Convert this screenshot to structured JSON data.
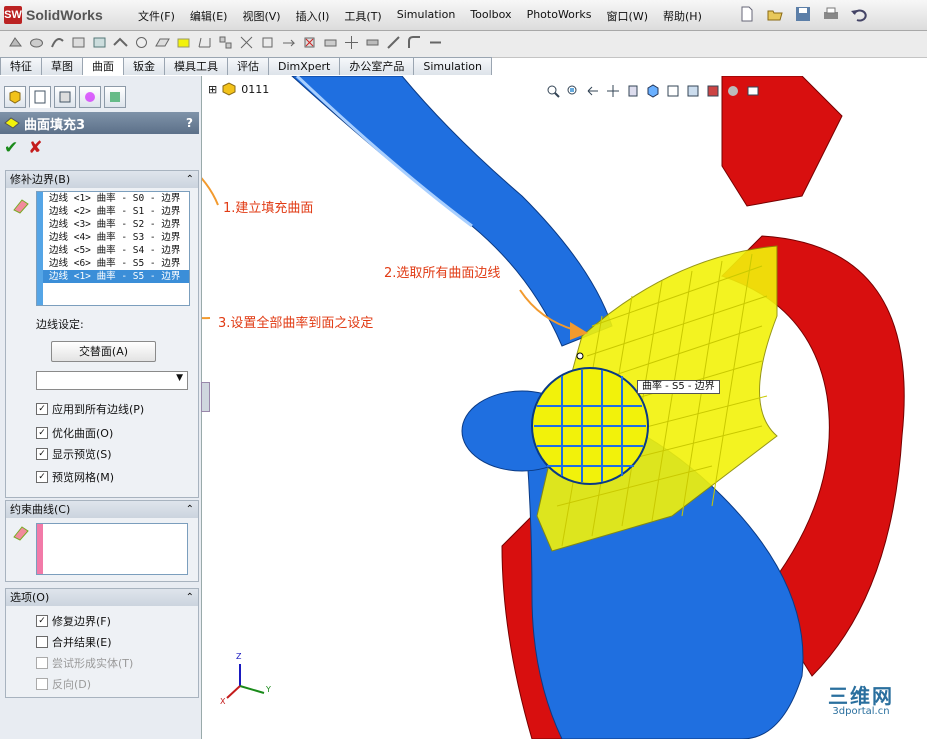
{
  "app": {
    "logo": "SolidWorks"
  },
  "menu": [
    "文件(F)",
    "编辑(E)",
    "视图(V)",
    "插入(I)",
    "工具(T)",
    "Simulation",
    "Toolbox",
    "PhotoWorks",
    "窗口(W)",
    "帮助(H)"
  ],
  "tabs": [
    {
      "label": "特征",
      "active": false
    },
    {
      "label": "草图",
      "active": false
    },
    {
      "label": "曲面",
      "active": true
    },
    {
      "label": "钣金",
      "active": false
    },
    {
      "label": "模具工具",
      "active": false
    },
    {
      "label": "评估",
      "active": false
    },
    {
      "label": "DimXpert",
      "active": false
    },
    {
      "label": "办公室产品",
      "active": false
    },
    {
      "label": "Simulation",
      "active": false
    }
  ],
  "tree": {
    "part_name": "0111"
  },
  "panel": {
    "title": "曲面填充3",
    "help": "?",
    "ok_glyph": "✔",
    "cancel_glyph": "✘",
    "patch_boundary": {
      "header": "修补边界(B)",
      "items": [
        "边线 <1> 曲率 - S0 - 边界",
        "边线 <2> 曲率 - S1 - 边界",
        "边线 <3> 曲率 - S2 - 边界",
        "边线 <4> 曲率 - S3 - 边界",
        "边线 <5> 曲率 - S4 - 边界",
        "边线 <6> 曲率 - S5 - 边界",
        "边线 <1> 曲率 - S5 - 边界"
      ],
      "selected_index": 6,
      "edge_settings_label": "边线设定:",
      "alternate_face_button": "交替面(A)",
      "combo_value": "",
      "options": [
        {
          "label": "应用到所有边线(P)",
          "checked": true
        },
        {
          "label": "优化曲面(O)",
          "checked": true
        },
        {
          "label": "显示预览(S)",
          "checked": true
        },
        {
          "label": "预览网格(M)",
          "checked": true
        }
      ]
    },
    "constraint_curves": {
      "header": "约束曲线(C)"
    },
    "options_group": {
      "header": "选项(O)",
      "items": [
        {
          "label": "修复边界(F)",
          "checked": true,
          "enabled": true
        },
        {
          "label": "合并结果(E)",
          "checked": false,
          "enabled": true
        },
        {
          "label": "尝试形成实体(T)",
          "checked": false,
          "enabled": false
        },
        {
          "label": "反向(D)",
          "checked": false,
          "enabled": false
        }
      ]
    }
  },
  "callouts": {
    "one": "1.建立填充曲面",
    "two": "2.选取所有曲面边线",
    "three": "3.设置全部曲率到面之设定"
  },
  "tooltip": "曲率 - S5 - 边界",
  "triad": {
    "x": "X",
    "y": "Y",
    "z": "Z"
  },
  "watermark": {
    "big": "三维网",
    "small": "3dportal.cn"
  },
  "colors": {
    "blue_body": "#1f6fe0",
    "red_body": "#d80f0f",
    "fill_mesh": "#f2f20a",
    "callout": "#e13b14"
  }
}
